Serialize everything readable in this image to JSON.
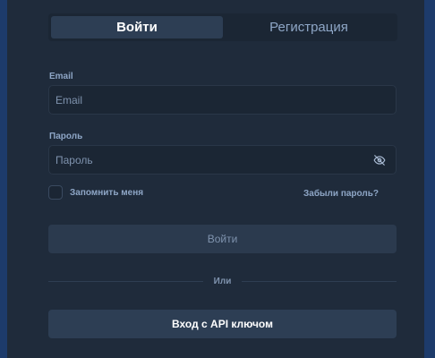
{
  "tabs": [
    {
      "label": "Войти",
      "active": true
    },
    {
      "label": "Регистрация",
      "active": false
    }
  ],
  "email": {
    "label": "Email",
    "placeholder": "Email",
    "value": ""
  },
  "password": {
    "label": "Пароль",
    "placeholder": "Пароль",
    "value": "",
    "toggle_icon": "eye-off-icon"
  },
  "remember_label": "Запомнить меня",
  "remember_checked": false,
  "forgot_label": "Забыли пароль?",
  "login_button": "Войти",
  "divider_text": "Или",
  "api_button": "Вход с API ключом",
  "colors": {
    "background": "#1f2b3b",
    "accent": "#2d3e54",
    "muted_text": "#8ea6c6"
  }
}
